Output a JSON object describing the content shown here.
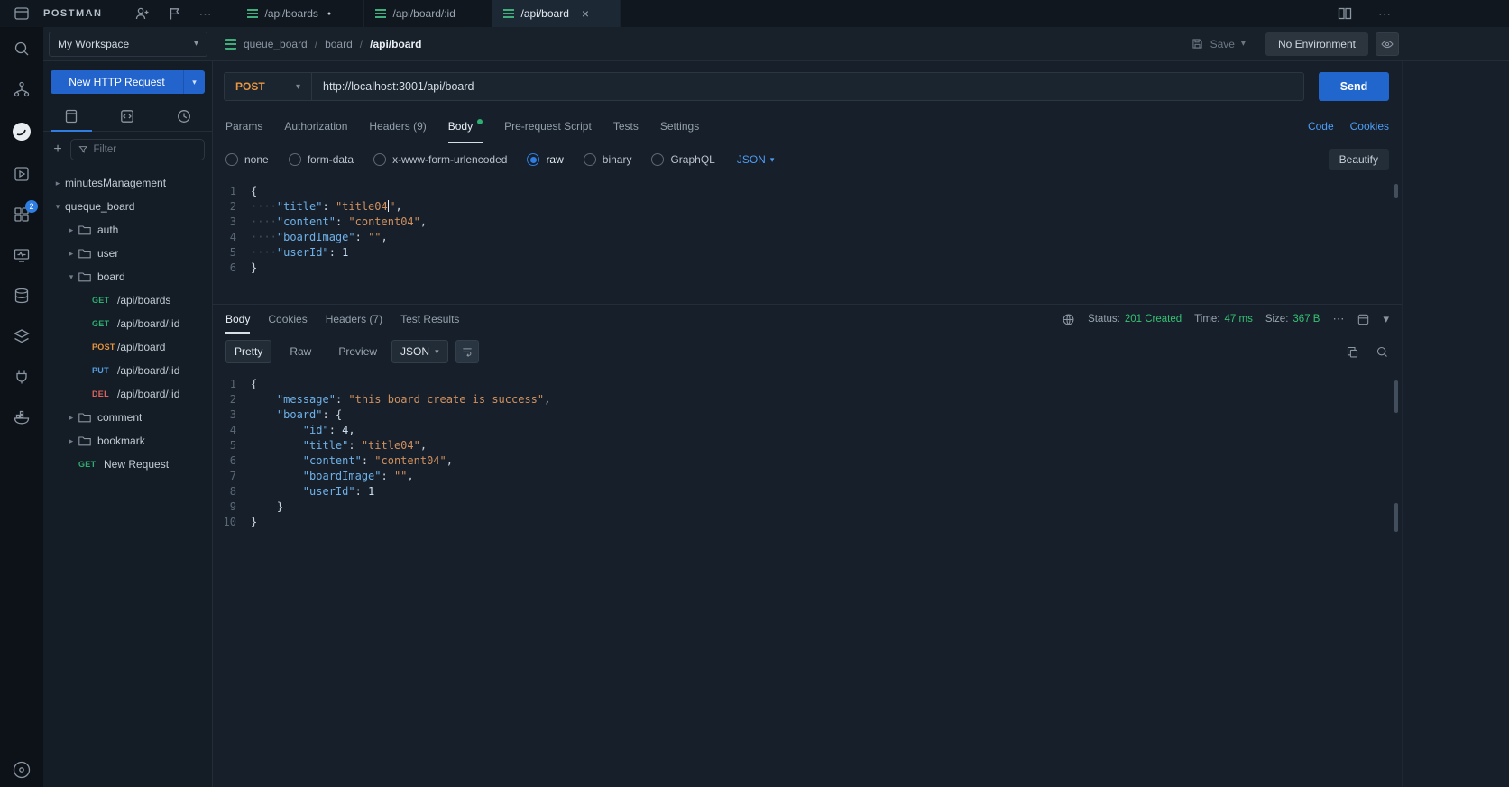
{
  "icons": {
    "ellipsis": "⋯",
    "chevron_down": "▾",
    "chevron_right": "▸",
    "plus": "+",
    "close": "×",
    "dirty_dot": "●",
    "separator": "/"
  },
  "topbar": {
    "brand": "POSTMAN",
    "tabs": [
      {
        "label": "/api/boards",
        "dirty": true,
        "active": false
      },
      {
        "label": "/api/board/:id",
        "dirty": false,
        "active": false
      },
      {
        "label": "/api/board",
        "dirty": false,
        "active": true
      }
    ],
    "strip_badge": "2"
  },
  "header": {
    "workspace": "My Workspace",
    "breadcrumb": [
      "queue_board",
      "board",
      "/api/board"
    ],
    "save_label": "Save",
    "environment": "No Environment"
  },
  "sidebar": {
    "new_request": "New HTTP Request",
    "filter_placeholder": "Filter",
    "tree": [
      {
        "kind": "collection",
        "label": "minutesManagement",
        "chevron": "right",
        "indent": 0
      },
      {
        "kind": "collection",
        "label": "queque_board",
        "chevron": "down",
        "indent": 0
      },
      {
        "kind": "folder",
        "label": "auth",
        "chevron": "right",
        "indent": 1
      },
      {
        "kind": "folder",
        "label": "user",
        "chevron": "right",
        "indent": 1
      },
      {
        "kind": "folder",
        "label": "board",
        "chevron": "down",
        "indent": 1
      },
      {
        "kind": "request",
        "method": "GET",
        "label": "/api/boards",
        "indent": 2
      },
      {
        "kind": "request",
        "method": "GET",
        "label": "/api/board/:id",
        "indent": 2
      },
      {
        "kind": "request",
        "method": "POST",
        "label": "/api/board",
        "indent": 2
      },
      {
        "kind": "request",
        "method": "PUT",
        "label": "/api/board/:id",
        "indent": 2
      },
      {
        "kind": "request",
        "method": "DEL",
        "label": "/api/board/:id",
        "indent": 2
      },
      {
        "kind": "folder",
        "label": "comment",
        "chevron": "right",
        "indent": 1
      },
      {
        "kind": "folder",
        "label": "bookmark",
        "chevron": "right",
        "indent": 1
      },
      {
        "kind": "request",
        "method": "GET",
        "label": "New Request",
        "indent": 1
      }
    ]
  },
  "request": {
    "method": "POST",
    "url": "http://localhost:3001/api/board",
    "send_label": "Send",
    "tabs": [
      {
        "label": "Params"
      },
      {
        "label": "Authorization"
      },
      {
        "label": "Headers",
        "count": "(9)"
      },
      {
        "label": "Body",
        "active": true,
        "dot": true
      },
      {
        "label": "Pre-request Script"
      },
      {
        "label": "Tests"
      },
      {
        "label": "Settings"
      }
    ],
    "links": [
      "Code",
      "Cookies"
    ],
    "body_modes": [
      {
        "label": "none"
      },
      {
        "label": "form-data"
      },
      {
        "label": "x-www-form-urlencoded"
      },
      {
        "label": "raw",
        "selected": true
      },
      {
        "label": "binary"
      },
      {
        "label": "GraphQL"
      }
    ],
    "raw_type": "JSON",
    "beautify_label": "Beautify",
    "editor": {
      "lines": [
        {
          "n": 1,
          "indent": 0,
          "tokens": [
            {
              "t": "punc",
              "v": "{"
            }
          ]
        },
        {
          "n": 2,
          "indent": 1,
          "tokens": [
            {
              "t": "key",
              "v": "\"title\""
            },
            {
              "t": "punc",
              "v": ": "
            },
            {
              "t": "str",
              "v": "\"title04"
            },
            {
              "t": "caret"
            },
            {
              "t": "str",
              "v": "\""
            },
            {
              "t": "punc",
              "v": ","
            }
          ]
        },
        {
          "n": 3,
          "indent": 1,
          "tokens": [
            {
              "t": "key",
              "v": "\"content\""
            },
            {
              "t": "punc",
              "v": ": "
            },
            {
              "t": "str",
              "v": "\"content04\""
            },
            {
              "t": "punc",
              "v": ","
            }
          ]
        },
        {
          "n": 4,
          "indent": 1,
          "tokens": [
            {
              "t": "key",
              "v": "\"boardImage\""
            },
            {
              "t": "punc",
              "v": ": "
            },
            {
              "t": "str",
              "v": "\"\""
            },
            {
              "t": "punc",
              "v": ","
            }
          ]
        },
        {
          "n": 5,
          "indent": 1,
          "tokens": [
            {
              "t": "key",
              "v": "\"userId\""
            },
            {
              "t": "punc",
              "v": ": "
            },
            {
              "t": "num",
              "v": "1"
            }
          ]
        },
        {
          "n": 6,
          "indent": 0,
          "tokens": [
            {
              "t": "punc",
              "v": "}"
            }
          ]
        }
      ]
    }
  },
  "response": {
    "tabs": [
      {
        "label": "Body",
        "active": true
      },
      {
        "label": "Cookies"
      },
      {
        "label": "Headers",
        "count": "(7)"
      },
      {
        "label": "Test Results"
      }
    ],
    "meta": [
      {
        "label": "Status:",
        "value": "201 Created"
      },
      {
        "label": "Time:",
        "value": "47 ms"
      },
      {
        "label": "Size:",
        "value": "367 B"
      }
    ],
    "view_modes": [
      {
        "label": "Pretty",
        "active": true
      },
      {
        "label": "Raw"
      },
      {
        "label": "Preview"
      }
    ],
    "format": "JSON",
    "editor": {
      "lines": [
        {
          "n": 1,
          "indent": 0,
          "tokens": [
            {
              "t": "punc",
              "v": "{"
            }
          ]
        },
        {
          "n": 2,
          "indent": 1,
          "tokens": [
            {
              "t": "key",
              "v": "\"message\""
            },
            {
              "t": "punc",
              "v": ": "
            },
            {
              "t": "str",
              "v": "\"this board create is success\""
            },
            {
              "t": "punc",
              "v": ","
            }
          ]
        },
        {
          "n": 3,
          "indent": 1,
          "tokens": [
            {
              "t": "key",
              "v": "\"board\""
            },
            {
              "t": "punc",
              "v": ": "
            },
            {
              "t": "punc",
              "v": "{"
            }
          ]
        },
        {
          "n": 4,
          "indent": 2,
          "tokens": [
            {
              "t": "key",
              "v": "\"id\""
            },
            {
              "t": "punc",
              "v": ": "
            },
            {
              "t": "num",
              "v": "4"
            },
            {
              "t": "punc",
              "v": ","
            }
          ]
        },
        {
          "n": 5,
          "indent": 2,
          "tokens": [
            {
              "t": "key",
              "v": "\"title\""
            },
            {
              "t": "punc",
              "v": ": "
            },
            {
              "t": "str",
              "v": "\"title04\""
            },
            {
              "t": "punc",
              "v": ","
            }
          ]
        },
        {
          "n": 6,
          "indent": 2,
          "tokens": [
            {
              "t": "key",
              "v": "\"content\""
            },
            {
              "t": "punc",
              "v": ": "
            },
            {
              "t": "str",
              "v": "\"content04\""
            },
            {
              "t": "punc",
              "v": ","
            }
          ]
        },
        {
          "n": 7,
          "indent": 2,
          "tokens": [
            {
              "t": "key",
              "v": "\"boardImage\""
            },
            {
              "t": "punc",
              "v": ": "
            },
            {
              "t": "str",
              "v": "\"\""
            },
            {
              "t": "punc",
              "v": ","
            }
          ]
        },
        {
          "n": 8,
          "indent": 2,
          "tokens": [
            {
              "t": "key",
              "v": "\"userId\""
            },
            {
              "t": "punc",
              "v": ": "
            },
            {
              "t": "num",
              "v": "1"
            }
          ]
        },
        {
          "n": 9,
          "indent": 1,
          "tokens": [
            {
              "t": "punc",
              "v": "}"
            }
          ]
        },
        {
          "n": 10,
          "indent": 0,
          "tokens": [
            {
              "t": "punc",
              "v": "}"
            }
          ]
        }
      ]
    }
  }
}
